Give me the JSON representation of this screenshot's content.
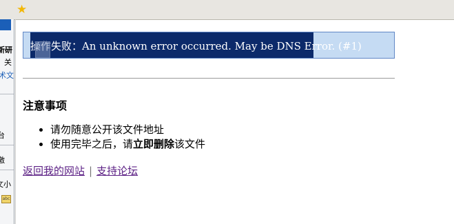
{
  "toolbar": {
    "favorite_icon": "star-icon"
  },
  "left_panel": {
    "fragments": [
      "新研",
      "关",
      "术文",
      "台",
      "激",
      "文小"
    ]
  },
  "error": {
    "label": "操作失败：",
    "message": "An unknown error occurred. May be DNS Error. (#1)"
  },
  "notes": {
    "title": "注意事项",
    "item1": "请勿随意公开该文件地址",
    "item2_prefix": "使用完毕之后，请",
    "item2_bold": "立即删除",
    "item2_suffix": "该文件"
  },
  "links": {
    "home": "返回我的网站",
    "separator": "|",
    "forum": "支持论坛"
  },
  "colors": {
    "selection_bg": "#0c2a6a",
    "box_bg": "#c5dbf3",
    "link": "#5b1f84"
  }
}
